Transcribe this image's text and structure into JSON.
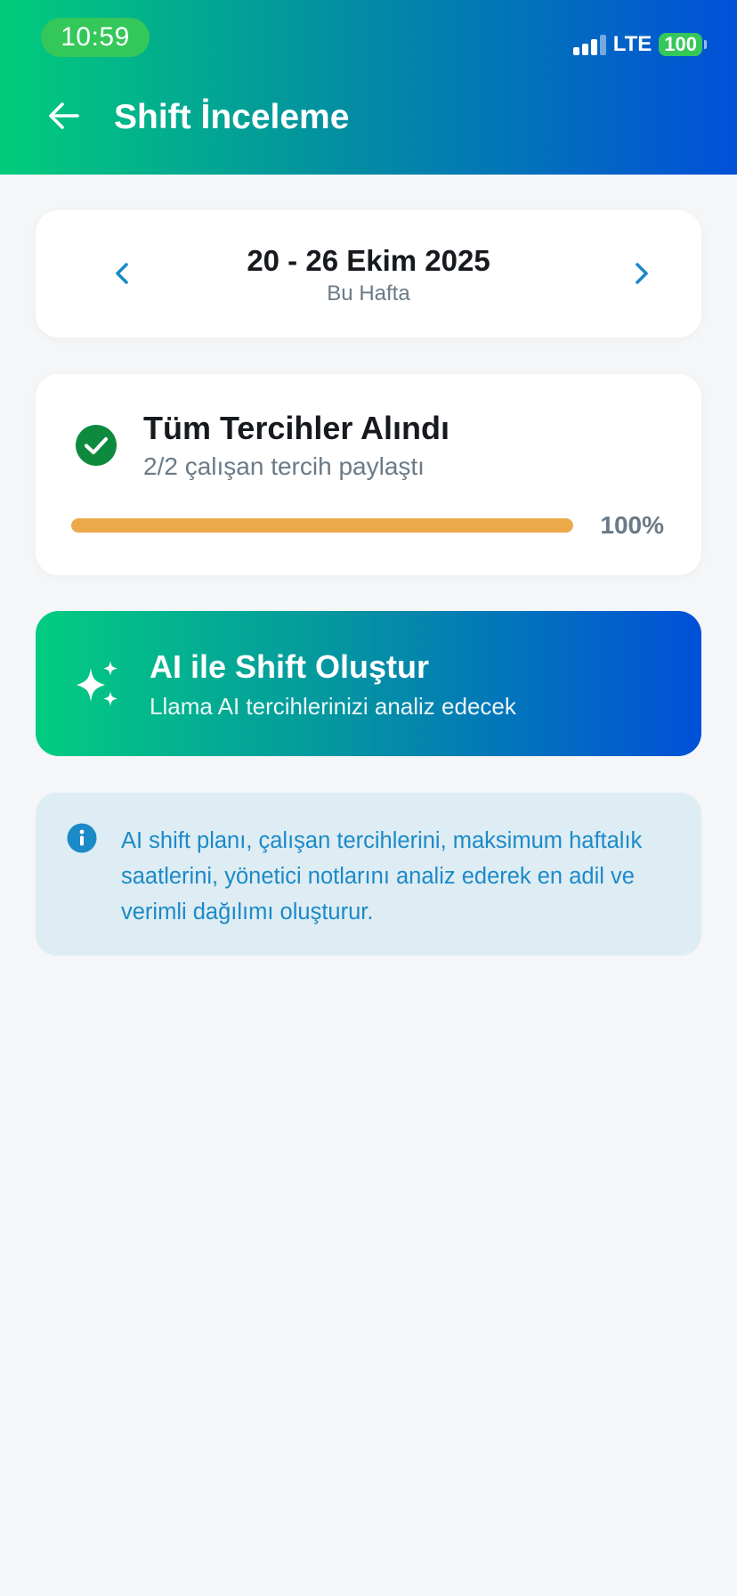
{
  "status_bar": {
    "time": "10:59",
    "network": "LTE",
    "battery": "100"
  },
  "header": {
    "title": "Shift İnceleme",
    "back_icon": "arrow-left-icon"
  },
  "week_selector": {
    "range": "20 - 26 Ekim 2025",
    "label": "Bu Hafta",
    "prev_icon": "chevron-left-icon",
    "next_icon": "chevron-right-icon"
  },
  "preferences": {
    "title": "Tüm Tercihler Alındı",
    "subtitle": "2/2 çalışan tercih paylaştı",
    "progress_percent": 100,
    "progress_label": "100%",
    "status_icon": "check-circle-icon"
  },
  "ai_action": {
    "title": "AI ile Shift Oluştur",
    "subtitle": "Llama AI tercihlerinizi analiz edecek",
    "icon": "sparkles-icon"
  },
  "info": {
    "text": "AI shift planı, çalışan tercihlerini, maksimum haftalık saatlerini, yönetici notlarını analiz ederek en adil ve verimli dağılımı oluşturur.",
    "icon": "info-icon"
  },
  "colors": {
    "accent_green": "#02cc7c",
    "accent_blue": "#0150d8",
    "progress": "#eca94a",
    "check": "#0e8a3e",
    "info_text": "#1b8ac8",
    "info_bg": "#deecf3"
  }
}
